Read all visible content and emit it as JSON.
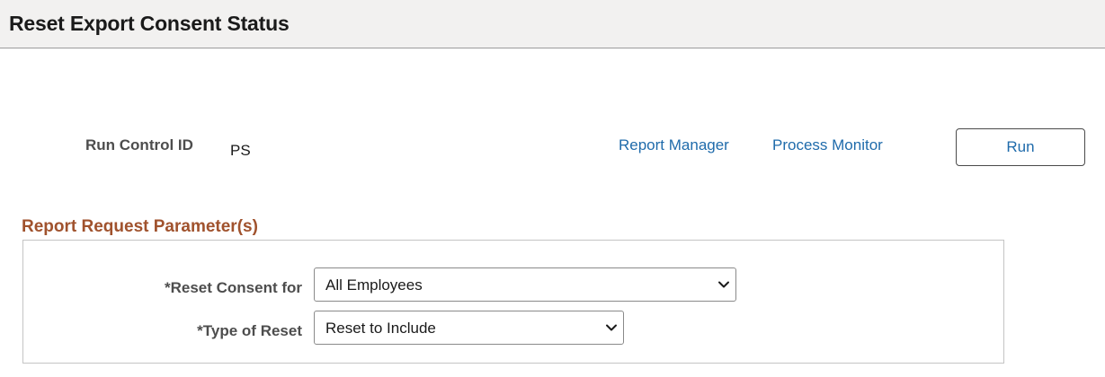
{
  "header": {
    "title": "Reset Export Consent Status"
  },
  "run_control": {
    "label": "Run Control ID",
    "value": "PS"
  },
  "links": {
    "report_manager": "Report Manager",
    "process_monitor": "Process Monitor"
  },
  "run_button": {
    "label": "Run"
  },
  "parameters": {
    "section_title": "Report Request Parameter(s)",
    "reset_consent_for": {
      "label": "*Reset Consent for",
      "selected": "All Employees"
    },
    "type_of_reset": {
      "label": "*Type of Reset",
      "selected": "Reset to Include"
    }
  },
  "colors": {
    "link": "#1f6bab",
    "section_title": "#a0522d",
    "header_bg": "#f2f1f0"
  }
}
